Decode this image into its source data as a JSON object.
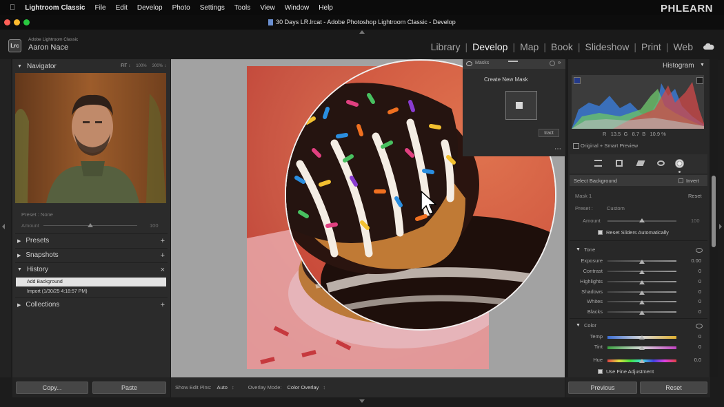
{
  "menubar": {
    "app_name": "Lightroom Classic",
    "items": [
      "File",
      "Edit",
      "Develop",
      "Photo",
      "Settings",
      "Tools",
      "View",
      "Window",
      "Help"
    ],
    "watermark": "PHLEARN"
  },
  "titlebar": {
    "title": "30 Days LR.lrcat - Adobe Photoshop Lightroom Classic - Develop"
  },
  "identity": {
    "badge": "Lrc",
    "product": "Adobe Lightroom Classic",
    "user": "Aaron Nace"
  },
  "modules": {
    "items": [
      "Library",
      "Develop",
      "Map",
      "Book",
      "Slideshow",
      "Print",
      "Web"
    ],
    "active": "Develop"
  },
  "left_panel": {
    "navigator_title": "Navigator",
    "zoom_options": [
      "FIT",
      "100%",
      "300%"
    ],
    "preset_label": "Preset : None",
    "amount_label": "Amount",
    "amount_value": "100",
    "sections": {
      "presets": "Presets",
      "snapshots": "Snapshots",
      "history": "History",
      "collections": "Collections"
    },
    "history_items": [
      "Add Background",
      "Import (1/30/25 4:18:57 PM)"
    ],
    "copy_button": "Copy...",
    "paste_button": "Paste"
  },
  "toolbar": {
    "pins_label": "Show Edit Pins:",
    "pins_value": "Auto",
    "overlay_label": "Overlay Mode:",
    "overlay_value": "Color Overlay"
  },
  "masks_panel": {
    "title": "Masks",
    "create_new": "Create New Mask",
    "subtract_partial": "tract"
  },
  "right_panel": {
    "histogram_title": "Histogram",
    "rgb": {
      "r_label": "R",
      "r_value": "13.5",
      "g_label": "G",
      "g_value": "8.7",
      "b_label": "B",
      "b_value": "10.9",
      "unit": "%"
    },
    "preview_label": "Original + Smart Preview",
    "select_background": "Select Background",
    "invert_label": "Invert",
    "mask_name": "Mask 1",
    "reset_link": "Reset",
    "preset_label": "Preset :",
    "preset_value": "Custom",
    "amount_label": "Amount",
    "amount_value": "100",
    "reset_sliders": "Reset Sliders Automatically",
    "tone_title": "Tone",
    "tone_sliders": [
      {
        "label": "Exposure",
        "value": "0.00"
      },
      {
        "label": "Contrast",
        "value": "0"
      },
      {
        "label": "Highlights",
        "value": "0"
      },
      {
        "label": "Shadows",
        "value": "0"
      },
      {
        "label": "Whites",
        "value": "0"
      },
      {
        "label": "Blacks",
        "value": "0"
      }
    ],
    "color_title": "Color",
    "color_sliders": [
      {
        "label": "Temp",
        "value": "0"
      },
      {
        "label": "Tint",
        "value": "0"
      },
      {
        "label": "Hue",
        "value": "0.0"
      }
    ],
    "fine_adjust": "Use Fine Adjustment",
    "previous_button": "Previous",
    "reset_button": "Reset"
  }
}
